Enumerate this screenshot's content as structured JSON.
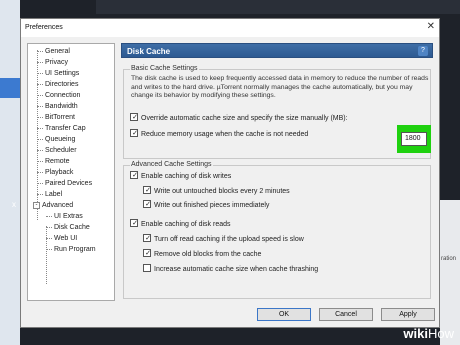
{
  "background": {
    "right_text": "ration",
    "left_x": "x"
  },
  "dialog": {
    "title": "Preferences",
    "close": "✕"
  },
  "tree": {
    "items": [
      {
        "label": "General"
      },
      {
        "label": "Privacy"
      },
      {
        "label": "UI Settings"
      },
      {
        "label": "Directories"
      },
      {
        "label": "Connection"
      },
      {
        "label": "Bandwidth"
      },
      {
        "label": "BitTorrent"
      },
      {
        "label": "Transfer Cap"
      },
      {
        "label": "Queueing"
      },
      {
        "label": "Scheduler"
      },
      {
        "label": "Remote"
      },
      {
        "label": "Playback"
      },
      {
        "label": "Paired Devices"
      },
      {
        "label": "Label"
      },
      {
        "label": "Advanced"
      },
      {
        "label": "UI Extras"
      },
      {
        "label": "Disk Cache"
      },
      {
        "label": "Web UI"
      },
      {
        "label": "Run Program"
      }
    ],
    "expanded_toggle": "-"
  },
  "panel": {
    "title": "Disk Cache",
    "help": "?",
    "basic": {
      "label": "Basic Cache Settings",
      "description": "The disk cache is used to keep frequently accessed data in memory to reduce the number of reads and writes to the hard drive. µTorrent normally manages the cache automatically, but you may change its behavior by modifying these settings.",
      "override_label": "Override automatic cache size and specify the size manually (MB):",
      "override_checked": true,
      "size_value": "1800",
      "reduce_label": "Reduce memory usage when the cache is not needed",
      "reduce_checked": true
    },
    "advanced": {
      "label": "Advanced Cache Settings",
      "enable_writes": "Enable caching of disk writes",
      "write_untouched": "Write out untouched blocks every 2 minutes",
      "write_finished": "Write out finished pieces immediately",
      "enable_reads": "Enable caching of disk reads",
      "turn_off_read": "Turn off read caching if the upload speed is slow",
      "remove_old": "Remove old blocks from the cache",
      "increase_auto": "Increase automatic cache size when cache thrashing",
      "increase_checked": false
    }
  },
  "buttons": {
    "ok": "OK",
    "cancel": "Cancel",
    "apply": "Apply"
  },
  "watermark": {
    "wiki": "wiki",
    "how": "How"
  }
}
